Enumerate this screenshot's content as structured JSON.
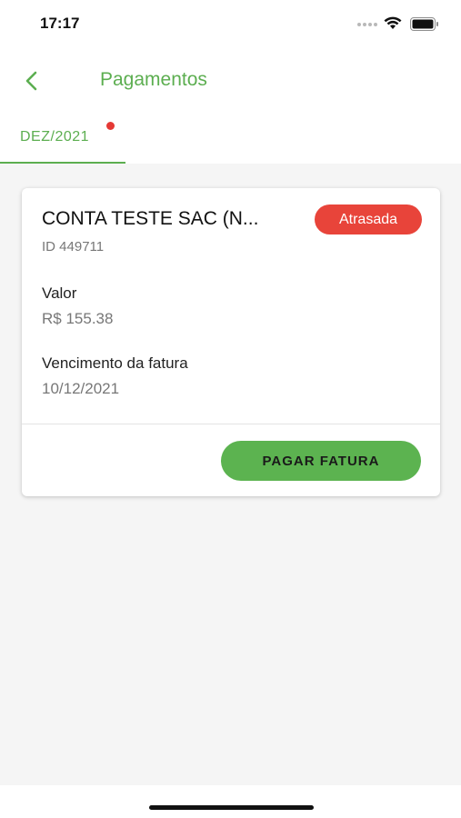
{
  "status_bar": {
    "time": "17:17",
    "icons": [
      "signal-dots-icon",
      "wifi-icon",
      "battery-icon"
    ]
  },
  "header": {
    "title": "Pagamentos",
    "back_icon": "chevron-left-icon"
  },
  "tabs": [
    {
      "label": "DEZ/2021",
      "active": true,
      "has_notification": true
    }
  ],
  "card": {
    "title": "CONTA TESTE SAC (N...",
    "id_text": "ID 449711",
    "status": "Atrasada",
    "value_label": "Valor",
    "value": "R$ 155.38",
    "due_label": "Vencimento da fatura",
    "due_date": "10/12/2021",
    "pay_button": "PAGAR FATURA"
  },
  "colors": {
    "accent": "#5cae50",
    "status_late": "#e8443a",
    "notification_dot": "#e53935",
    "background": "#f5f5f5"
  }
}
